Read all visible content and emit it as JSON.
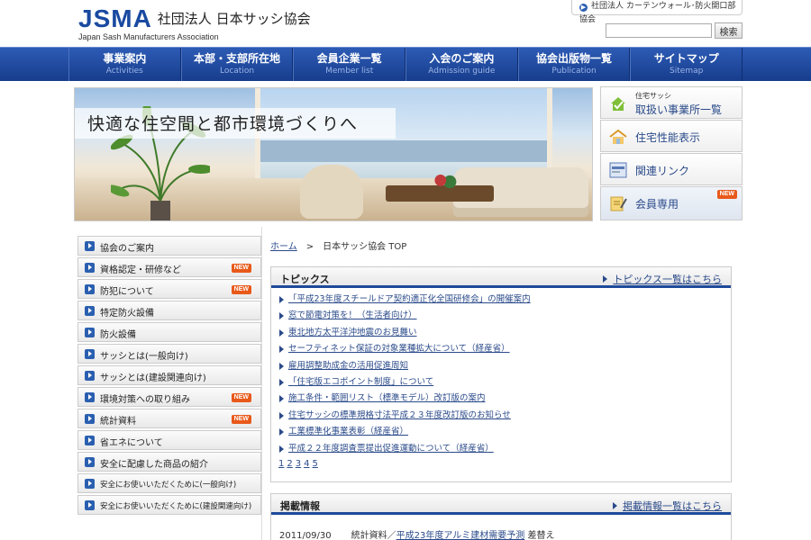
{
  "header": {
    "logo_main": "JSMA",
    "logo_org": "社団法人 日本サッシ協会",
    "logo_sub": "Japan Sash Manufacturers Association",
    "related_link": "社団法人 カーテンウォール･防火開口部協会",
    "search_placeholder": "",
    "search_button": "検索"
  },
  "nav": [
    {
      "jp": "事業案内",
      "en": "Activities"
    },
    {
      "jp": "本部・支部所在地",
      "en": "Location"
    },
    {
      "jp": "会員企業一覧",
      "en": "Member list"
    },
    {
      "jp": "入会のご案内",
      "en": "Admission guide"
    },
    {
      "jp": "協会出版物一覧",
      "en": "Publication"
    },
    {
      "jp": "サイトマップ",
      "en": "Sitemap"
    }
  ],
  "hero": {
    "caption": "快適な住空間と都市環境づくりへ"
  },
  "right_menu": {
    "dealers_small": "住宅サッシ",
    "dealers": "取扱い事業所一覧",
    "performance": "住宅性能表示",
    "links": "関連リンク",
    "members": "会員専用",
    "new_label": "NEW"
  },
  "side_menu": [
    {
      "label": "協会のご案内",
      "new": false
    },
    {
      "label": "資格認定・研修など",
      "new": true
    },
    {
      "label": "防犯について",
      "new": true
    },
    {
      "label": "特定防火設備",
      "new": false
    },
    {
      "label": "防火設備",
      "new": false
    },
    {
      "label": "サッシとは(一般向け)",
      "new": false
    },
    {
      "label": "サッシとは(建設関連向け)",
      "new": false
    },
    {
      "label": "環境対策への取り組み",
      "new": true
    },
    {
      "label": "統計資料",
      "new": true
    },
    {
      "label": "省エネについて",
      "new": false
    },
    {
      "label": "安全に配慮した商品の紹介",
      "new": false
    },
    {
      "label": "安全にお使いいただくために(一般向け)",
      "new": false
    },
    {
      "label": "安全にお使いいただくために(建設関連向け)",
      "new": false
    }
  ],
  "breadcrumb": {
    "home": "ホーム",
    "sep": ">",
    "current": "日本サッシ協会 TOP"
  },
  "topics": {
    "title": "トピックス",
    "more": "トピックス一覧はこちら",
    "items": [
      "「平成23年度スチールドア契約適正化全国研修会」の開催案内",
      "窓で節電対策を！（生活者向け）",
      "東北地方太平洋沖地震のお見舞い",
      "セーフティネット保証の対象業種拡大について（経産省）",
      "雇用調整助成金の活用促進周知",
      "「住宅版エコポイント制度」について",
      "施工条件・範囲リスト（標準モデル）改訂版の案内",
      "住宅サッシの標準規格寸法平成２３年度改訂版のお知らせ",
      "工業標準化事業表彰（経産省）",
      "平成２２年度調査票提出促進運動について（経産省）"
    ],
    "pages": [
      "1",
      "2",
      "3",
      "4",
      "5"
    ]
  },
  "publish": {
    "title": "掲載情報",
    "more": "掲載情報一覧はこちら",
    "date": "2011/09/30",
    "category": "統計資料／",
    "link": "平成23年度アルミ建材需要予測",
    "suffix": " 差替え"
  },
  "colors": {
    "brand": "#1a4aa0",
    "nav": "#1e4a9a",
    "new_badge": "#e8591a",
    "link": "#2a4a8a"
  }
}
